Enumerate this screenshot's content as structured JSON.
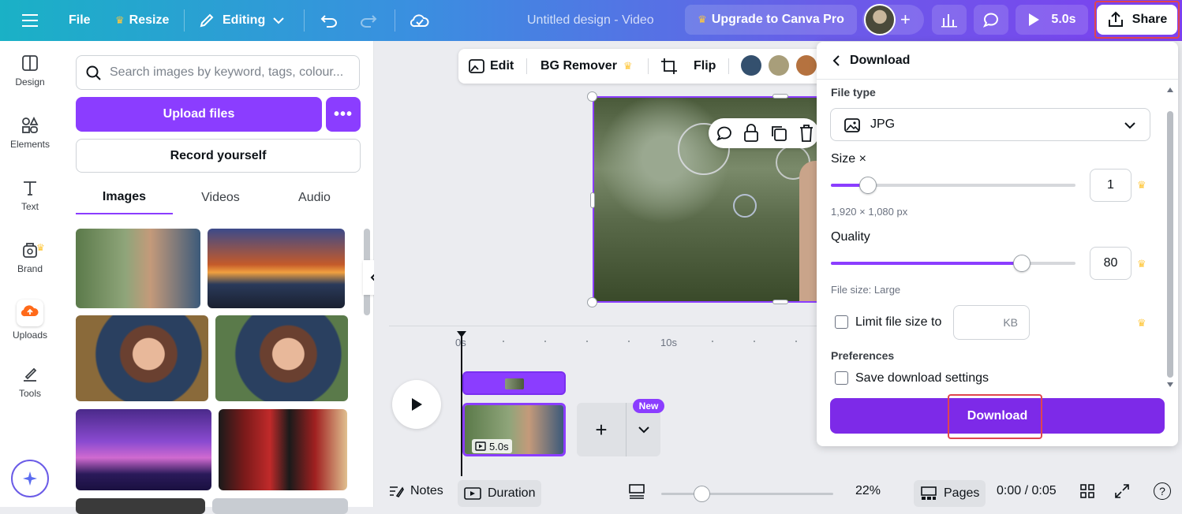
{
  "topbar": {
    "file_label": "File",
    "resize_label": "Resize",
    "editing_label": "Editing",
    "doc_title": "Untitled design - Video",
    "upgrade_label": "Upgrade to Canva Pro",
    "duration_label": "5.0s",
    "share_label": "Share"
  },
  "sidenav": {
    "items": [
      {
        "label": "Design",
        "icon": "design-icon"
      },
      {
        "label": "Elements",
        "icon": "elements-icon"
      },
      {
        "label": "Text",
        "icon": "text-icon"
      },
      {
        "label": "Brand",
        "icon": "brand-icon"
      },
      {
        "label": "Uploads",
        "icon": "uploads-icon"
      },
      {
        "label": "Tools",
        "icon": "tools-icon"
      }
    ]
  },
  "panel": {
    "search_placeholder": "Search images by keyword, tags, colour...",
    "upload_label": "Upload files",
    "more_label": "•••",
    "record_label": "Record yourself",
    "tabs": [
      "Images",
      "Videos",
      "Audio"
    ]
  },
  "context_toolbar": {
    "edit_label": "Edit",
    "bg_remover_label": "BG Remover",
    "flip_label": "Flip",
    "swatches": [
      "#34506e",
      "#a89e7a",
      "#b5723f"
    ]
  },
  "timeline": {
    "mark_0": "0s",
    "mark_10": "10s",
    "clip_duration": "5.0s",
    "new_badge": "New"
  },
  "bottombar": {
    "notes_label": "Notes",
    "duration_label": "Duration",
    "zoom_value": "22%",
    "pages_label": "Pages",
    "time_label": "0:00 / 0:05",
    "help_label": "?"
  },
  "download": {
    "title": "Download",
    "file_type_label": "File type",
    "file_type_value": "JPG",
    "size_label": "Size ×",
    "size_value": "1",
    "size_fraction": 0.15,
    "dimensions": "1,920 × 1,080 px",
    "quality_label": "Quality",
    "quality_value": "80",
    "quality_fraction": 0.78,
    "file_size_text": "File size: Large",
    "limit_label": "Limit file size to",
    "limit_unit": "KB",
    "preferences_label": "Preferences",
    "save_settings_label": "Save download settings",
    "download_button": "Download"
  },
  "colors": {
    "accent": "#8b3dff",
    "download_button": "#7d2ae8",
    "highlight": "#e0454f"
  }
}
